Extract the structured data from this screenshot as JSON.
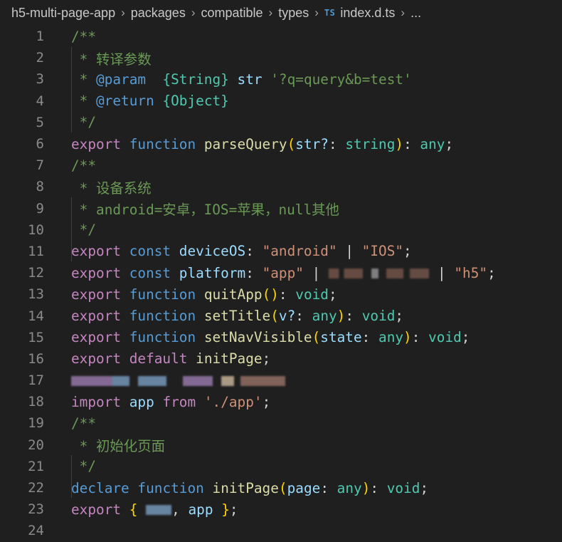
{
  "breadcrumb": {
    "items": [
      "h5-multi-page-app",
      "packages",
      "compatible",
      "types",
      "index.d.ts",
      "..."
    ],
    "file_badge": "TS"
  },
  "lines": {
    "n": [
      "1",
      "2",
      "3",
      "4",
      "5",
      "6",
      "7",
      "8",
      "9",
      "10",
      "11",
      "12",
      "13",
      "14",
      "15",
      "16",
      "17",
      "18",
      "19",
      "20",
      "21",
      "22",
      "23",
      "24"
    ],
    "l1_open": "/**",
    "l2_text": " * 转译参数",
    "l3_star": " * ",
    "l3_tag": "@param",
    "l3_type": "{String}",
    "l3_name": "str",
    "l3_str": "'?q=query&b=test'",
    "l4_star": " * ",
    "l4_tag": "@return",
    "l4_type": "{Object}",
    "l5_close": " */",
    "l6": {
      "export": "export",
      "function": "function",
      "name": "parseQuery",
      "p1": "(",
      "param": "str?",
      "colon": ": ",
      "type": "string",
      "p2": ")",
      "rest": ": ",
      "ret": "any",
      ";": ";"
    },
    "l7_open": "/**",
    "l8_text": " * 设备系统",
    "l9_text": " * android=安卓，IOS=苹果，null其他",
    "l10_close": " */",
    "l11": {
      "export": "export",
      "const": "const",
      "name": "deviceOS",
      "colon": ": ",
      "s1": "\"android\"",
      "bar": " | ",
      "s2": "\"IOS\"",
      "semi": ";"
    },
    "l12": {
      "export": "export",
      "const": "const",
      "name": "platform",
      "colon": ": ",
      "s1": "\"app\"",
      "bar": " | ",
      "s3": "\"h5\"",
      "semi": ";"
    },
    "l13": {
      "export": "export",
      "function": "function",
      "name": "quitApp",
      "parens": "()",
      "colon": ": ",
      "ret": "void",
      "semi": ";"
    },
    "l14": {
      "export": "export",
      "function": "function",
      "name": "setTitle",
      "p1": "(",
      "param": "v?",
      "colon": ": ",
      "type": "any",
      "p2": ")",
      "colon2": ": ",
      "ret": "void",
      "semi": ";"
    },
    "l15": {
      "export": "export",
      "function": "function",
      "name": "setNavVisible",
      "p1": "(",
      "param": "state",
      "colon": ": ",
      "type": "any",
      "p2": ")",
      "colon2": ": ",
      "ret": "void",
      "semi": ";"
    },
    "l16": {
      "export": "export",
      "default": "default",
      "name": "initPage",
      "semi": ";"
    },
    "l18": {
      "import": "import",
      "name": "app",
      "from": "from",
      "path": "'./app'",
      "semi": ";"
    },
    "l19_open": "/**",
    "l20_text": " * 初始化页面",
    "l21_close": " */",
    "l22": {
      "declare": "declare",
      "function": "function",
      "name": "initPage",
      "p1": "(",
      "param": "page",
      "colon": ": ",
      "type": "any",
      "p2": ")",
      "colon2": ": ",
      "ret": "void",
      "semi": ";"
    },
    "l23": {
      "export": "export",
      "b1": "{",
      "comma": ",",
      "name": "app",
      "b2": "}",
      "semi": ";"
    }
  }
}
